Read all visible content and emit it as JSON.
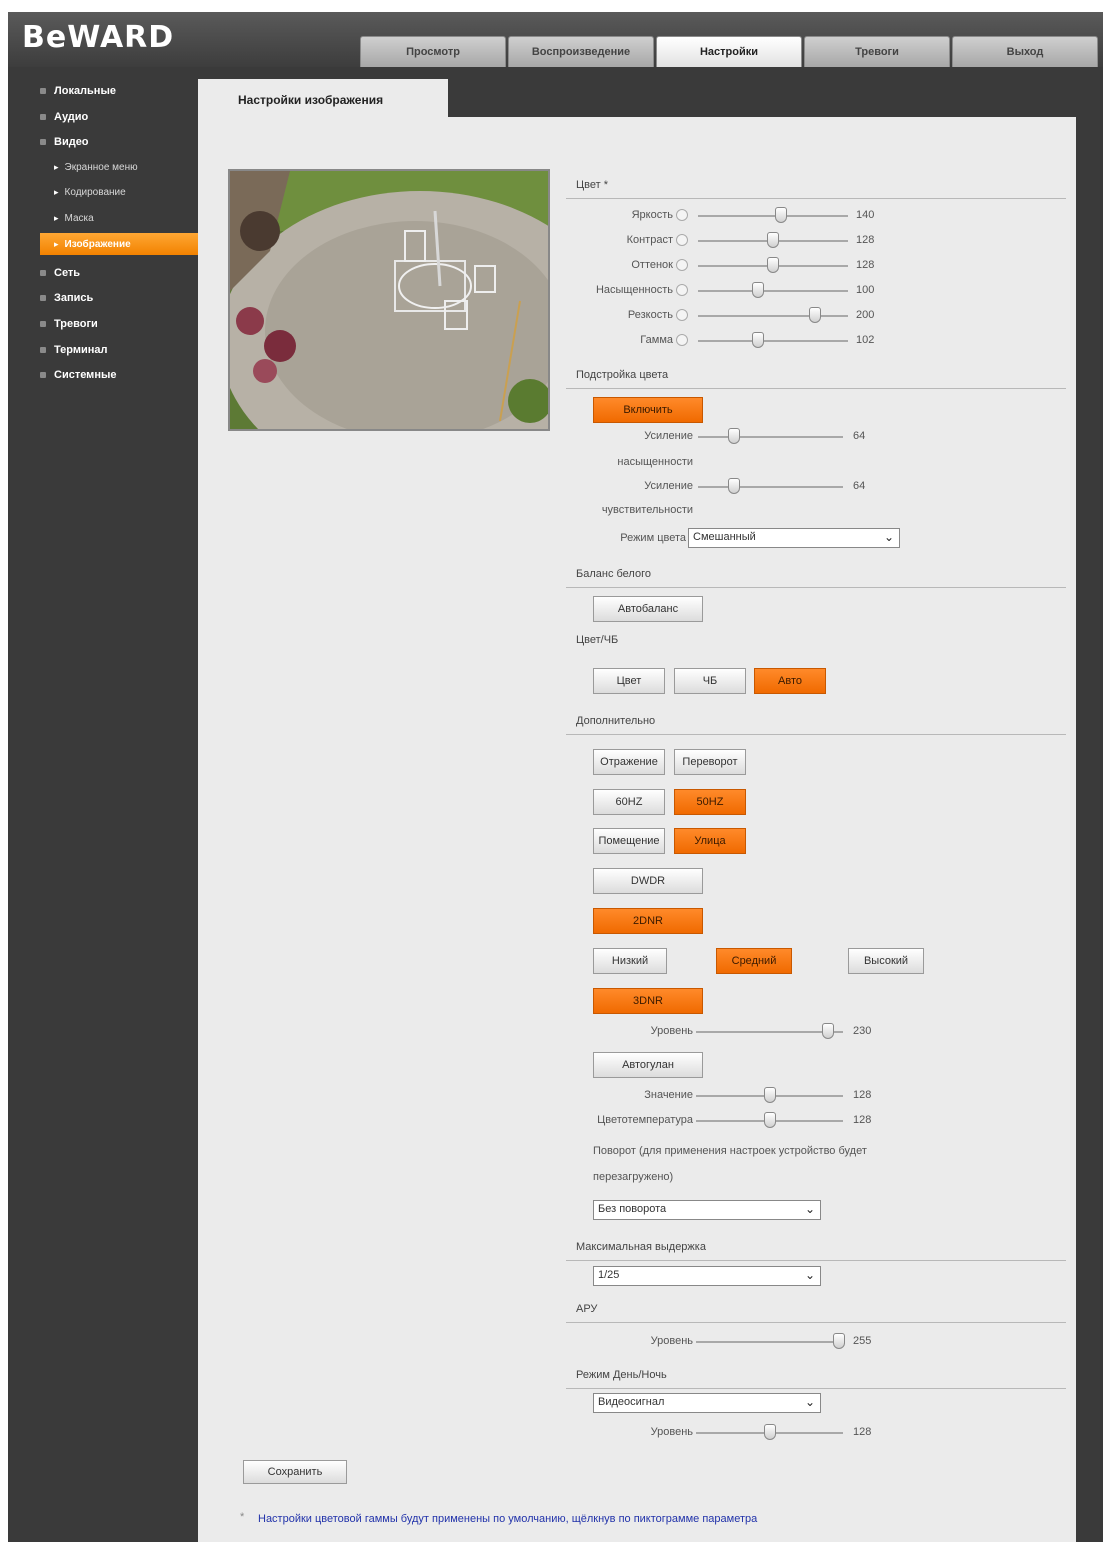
{
  "logo": "BeWARD",
  "tabs": [
    "Просмотр",
    "Воспроизведение",
    "Настройки",
    "Тревоги",
    "Выход"
  ],
  "active_tab": "Настройки",
  "sidebar": {
    "items": [
      "Локальные",
      "Аудио",
      "Видео",
      "Сеть",
      "Запись",
      "Тревоги",
      "Терминал",
      "Системные"
    ],
    "video_sub": [
      "Экранное меню",
      "Кодирование",
      "Маска",
      "Изображение"
    ],
    "active_sub": "Изображение"
  },
  "page_tab": "Настройки изображения",
  "color": {
    "section": "Цвет *",
    "sliders": [
      {
        "label": "Яркость",
        "value": "140",
        "level": 0.55
      },
      {
        "label": "Контраст",
        "value": "128",
        "level": 0.5
      },
      {
        "label": "Оттенок",
        "value": "128",
        "level": 0.5
      },
      {
        "label": "Насыщенность",
        "value": "100",
        "level": 0.4
      },
      {
        "label": "Резкость",
        "value": "200",
        "level": 0.78
      },
      {
        "label": "Гамма",
        "value": "102",
        "level": 0.4
      }
    ]
  },
  "color_boost": {
    "section": "Подстройка цвета",
    "enable_btn": "Включить",
    "sliders": [
      {
        "label": "Усиление",
        "label2": "насыщенности",
        "value": "64",
        "level": 0.25
      },
      {
        "label": "Усиление",
        "label2": "чувствительности",
        "value": "64",
        "level": 0.25
      }
    ],
    "mode_label": "Режим цвета",
    "mode_value": "Смешанный"
  },
  "white_balance": {
    "section": "Баланс белого",
    "btn": "Автобаланс"
  },
  "color_bw": {
    "section": "Цвет/ЧБ",
    "buttons": [
      "Цвет",
      "ЧБ",
      "Авто"
    ],
    "active": "Авто"
  },
  "extra": {
    "section": "Дополнительно",
    "row1": [
      "Отражение",
      "Переворот"
    ],
    "row2": [
      "60HZ",
      "50HZ"
    ],
    "row3": [
      "Помещение",
      "Улица"
    ],
    "dwdr": "DWDR",
    "twodnr": "2DNR",
    "levels": [
      "Низкий",
      "Средний",
      "Высокий"
    ],
    "threednr": "3DNR",
    "level_label": "Уровень",
    "level_value": "230",
    "level_level": 0.9,
    "autogain_btn": "Автогулан",
    "value_label": "Значение",
    "value_value": "128",
    "value_level": 0.5,
    "ct_label": "Цветотемпература",
    "ct_value": "128",
    "ct_level": 0.5,
    "rotate_note_1": "Поворот (для применения настроек устройство будет",
    "rotate_note_2": "перезагружено)",
    "rotate_value": "Без поворота"
  },
  "max_exposure": {
    "section": "Максимальная выдержка",
    "value": "1/25"
  },
  "agc": {
    "section": "АРУ",
    "label": "Уровень",
    "value": "255",
    "level": 0.97
  },
  "daynight": {
    "section": "Режим День/Ночь",
    "mode": "Видеосигнал",
    "label": "Уровень",
    "value": "128",
    "level": 0.5
  },
  "save_btn": "Сохранить",
  "hint_star": "*",
  "hint": "Настройки цветовой гаммы будут применены по умолчанию, щёлкнув по пиктограмме параметра"
}
